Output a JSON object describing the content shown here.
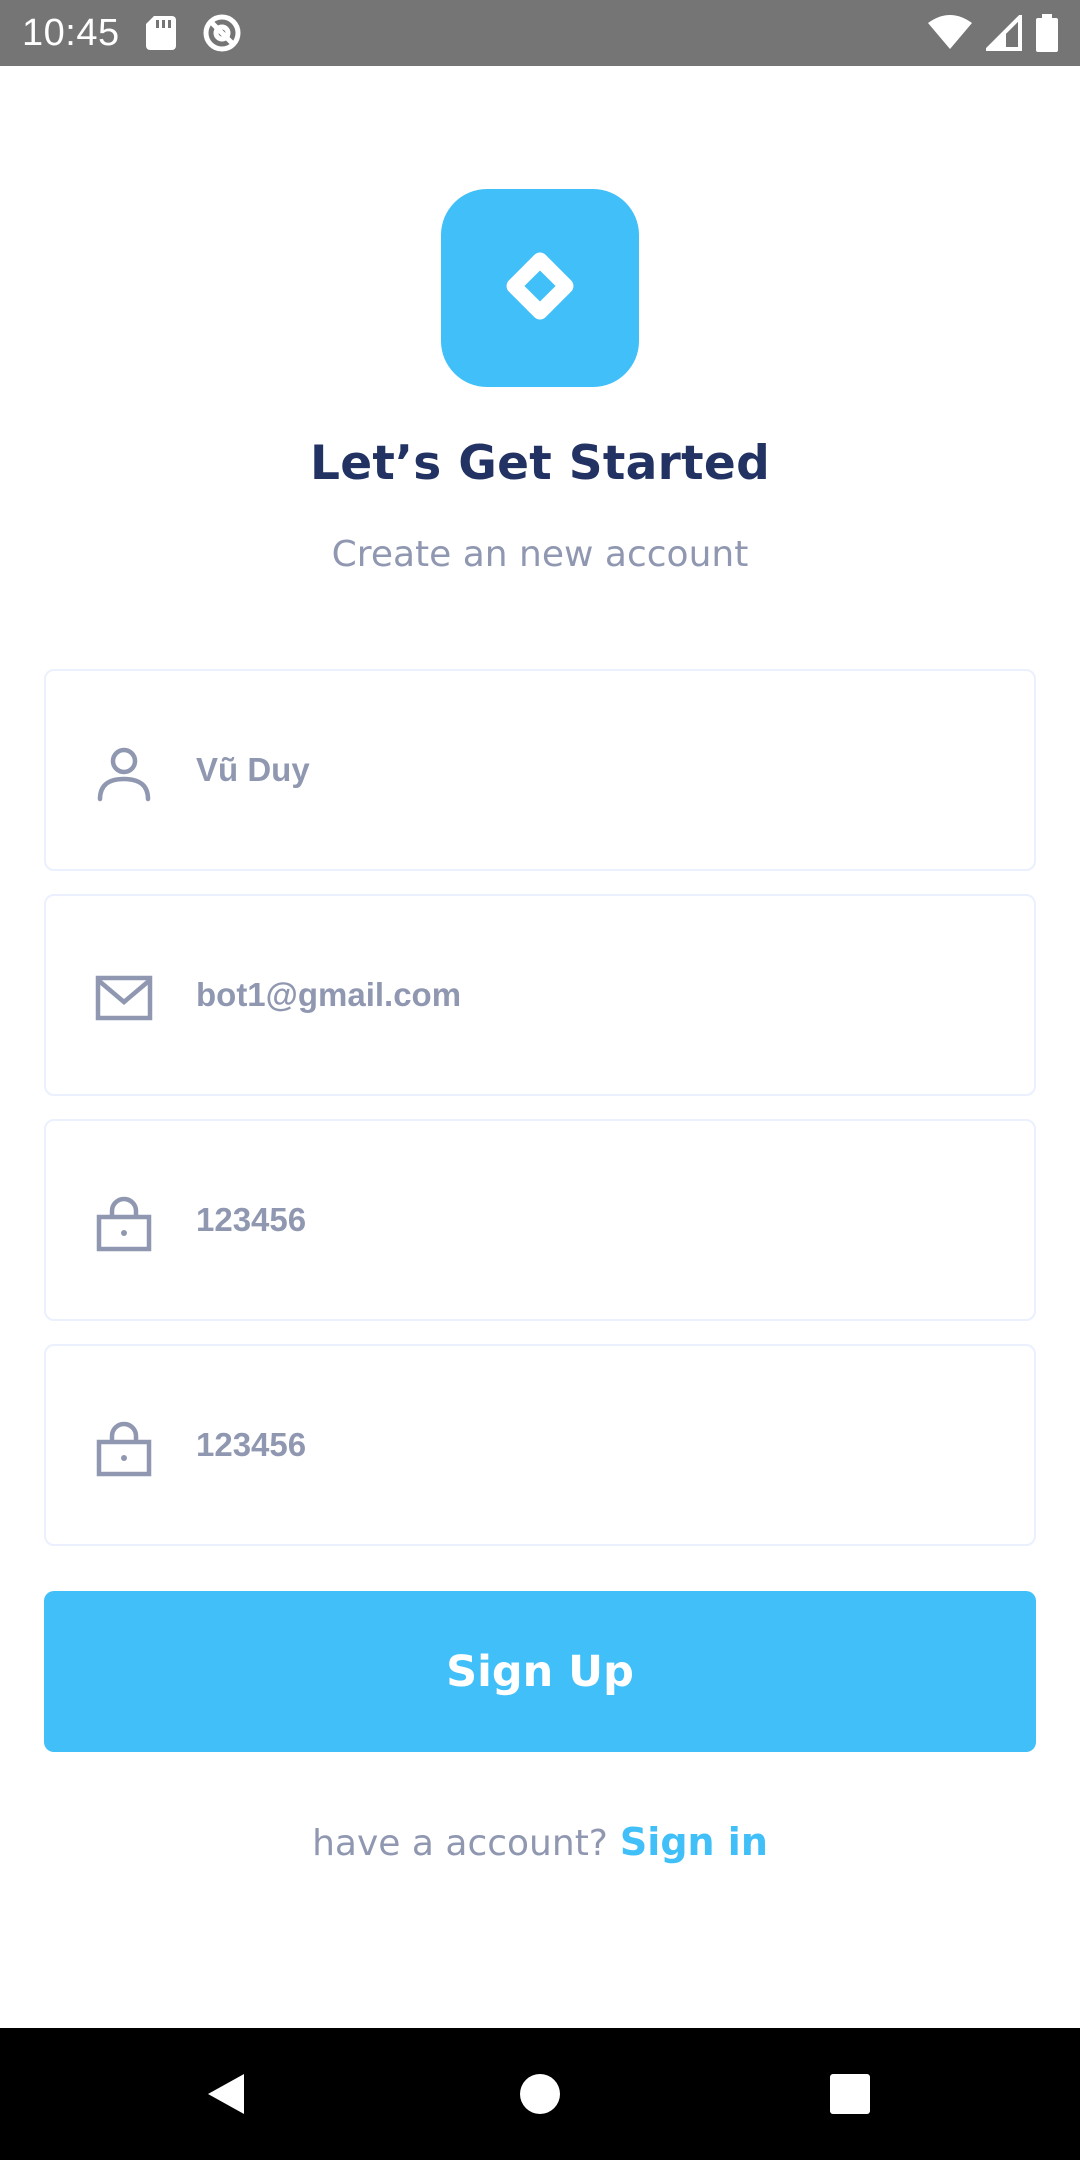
{
  "status_bar": {
    "time": "10:45",
    "icons_left": [
      "sd-card-icon",
      "at-sign-icon"
    ],
    "icons_right": [
      "wifi-icon",
      "signal-icon",
      "battery-icon"
    ]
  },
  "logo": {
    "icon": "diamond-icon",
    "color": "#40bff8"
  },
  "header": {
    "title": "Let’s Get Started",
    "subtitle": "Create an new account"
  },
  "form": {
    "fields": [
      {
        "name": "full-name",
        "icon": "user-icon",
        "value": "Vũ Duy"
      },
      {
        "name": "email",
        "icon": "mail-icon",
        "value": "bot1@gmail.com"
      },
      {
        "name": "password",
        "icon": "lock-icon",
        "value": "123456"
      },
      {
        "name": "confirm-password",
        "icon": "lock-icon",
        "value": "123456"
      }
    ],
    "submit_label": "Sign Up"
  },
  "footer": {
    "prompt": "have a account?",
    "link_label": "Sign in"
  },
  "nav_bar": {
    "buttons": [
      "back-icon",
      "home-icon",
      "recents-icon"
    ]
  },
  "colors": {
    "primary": "#40bff8",
    "heading": "#223263",
    "muted": "#9098b1",
    "border": "#ebf0ff"
  }
}
